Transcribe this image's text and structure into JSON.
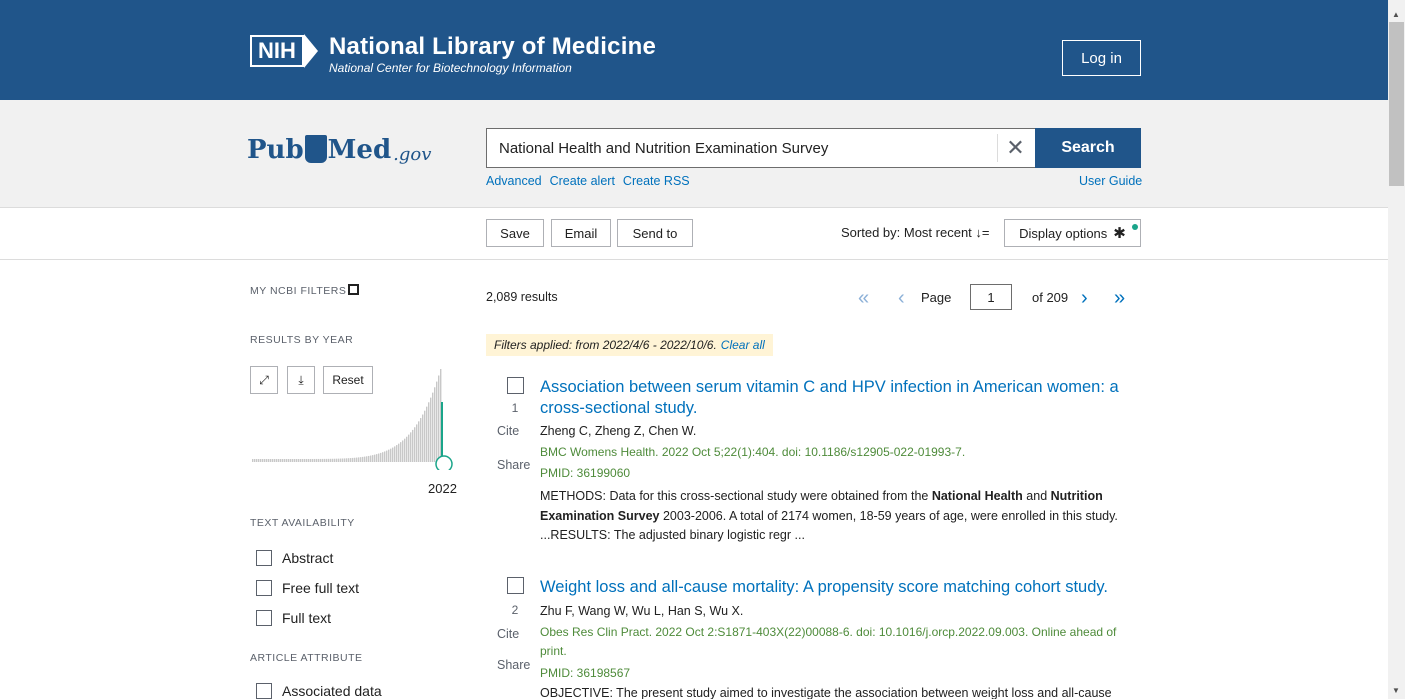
{
  "header": {
    "nih": "NIH",
    "title": "National Library of Medicine",
    "subtitle": "National Center for Biotechnology Information",
    "login_label": "Log in"
  },
  "search": {
    "logo_pub": "Pub",
    "logo_med": "Med",
    "logo_gov": ".gov",
    "query": "National Health and Nutrition Examination Survey",
    "button_label": "Search",
    "links": [
      "Advanced",
      "Create alert",
      "Create RSS"
    ],
    "user_guide": "User Guide"
  },
  "actions": {
    "save": "Save",
    "email": "Email",
    "send_to": "Send to",
    "sorted_by": "Sorted by: Most recent",
    "display_options": "Display options"
  },
  "filters": {
    "my_ncbi": "MY NCBI FILTERS",
    "results_by_year": "RESULTS BY YEAR",
    "reset": "Reset",
    "year": "2022",
    "text_availability": "TEXT AVAILABILITY",
    "text_options": [
      "Abstract",
      "Free full text",
      "Full text"
    ],
    "article_attribute": "ARTICLE ATTRIBUTE",
    "attribute_options": [
      "Associated data"
    ]
  },
  "results": {
    "count": "2,089 results",
    "page_label": "Page",
    "page_value": "1",
    "page_of": "of 209",
    "filters_applied": "Filters applied: from 2022/4/6 - 2022/10/6.",
    "clear_all": "Clear all",
    "side_cite": "Cite",
    "side_share": "Share",
    "items": [
      {
        "num": "1",
        "title": "Association between serum vitamin C and HPV infection in American women: a cross-sectional study.",
        "authors": "Zheng C, Zheng Z, Chen W.",
        "citation": "BMC Womens Health. 2022 Oct 5;22(1):404. doi: 10.1186/s12905-022-01993-7.",
        "pmid": "PMID: 36199060",
        "snippet_1": "METHODS: Data for this cross-sectional study were obtained from the ",
        "snippet_b1": "National Health",
        "snippet_2": " and ",
        "snippet_b2": "Nutrition Examination Survey",
        "snippet_3": " 2003-2006. A total of 2174 women, 18-59 years of age, were enrolled in this study. ...RESULTS: The adjusted binary logistic regr ..."
      },
      {
        "num": "2",
        "title": "Weight loss and all-cause mortality: A propensity score matching cohort study.",
        "authors": "Zhu F, Wang W, Wu L, Han S, Wu X.",
        "citation": "Obes Res Clin Pract. 2022 Oct 2:S1871-403X(22)00088-6. doi: 10.1016/j.orcp.2022.09.003. Online ahead of print.",
        "pmid": "PMID: 36198567",
        "snippet": "OBJECTIVE: The present study aimed to investigate the association between weight loss and all-cause"
      }
    ]
  },
  "colors": {
    "brand": "#20558a",
    "link": "#0071bc",
    "citation": "#4e8b3a",
    "filter_bg": "#fff4d6",
    "chart_accent": "#1aa58a"
  },
  "icons": [
    "nih-logo-icon",
    "close-icon",
    "sort-icon",
    "gear-icon",
    "external-link-icon",
    "expand-icon",
    "download-icon",
    "first-page-icon",
    "prev-page-icon",
    "next-page-icon",
    "last-page-icon"
  ]
}
